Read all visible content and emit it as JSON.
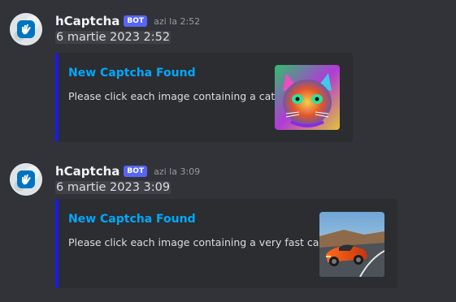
{
  "messages": [
    {
      "username": "hCaptcha",
      "bot_tag": "BOT",
      "timestamp": "azi la 2:52",
      "content": "6 martie 2023 2:52",
      "embed": {
        "title": "New Captcha Found",
        "description": "Please click each image containing a cat",
        "accent_color": "#1a1ae6",
        "thumbnail": "colorful-cat-image"
      }
    },
    {
      "username": "hCaptcha",
      "bot_tag": "BOT",
      "timestamp": "azi la 3:09",
      "content": "6 martie 2023 3:09",
      "embed": {
        "title": "New Captcha Found",
        "description": "Please click each image containing a very fast car",
        "accent_color": "#1a1ae6",
        "thumbnail": "orange-sports-car-image"
      }
    }
  ]
}
